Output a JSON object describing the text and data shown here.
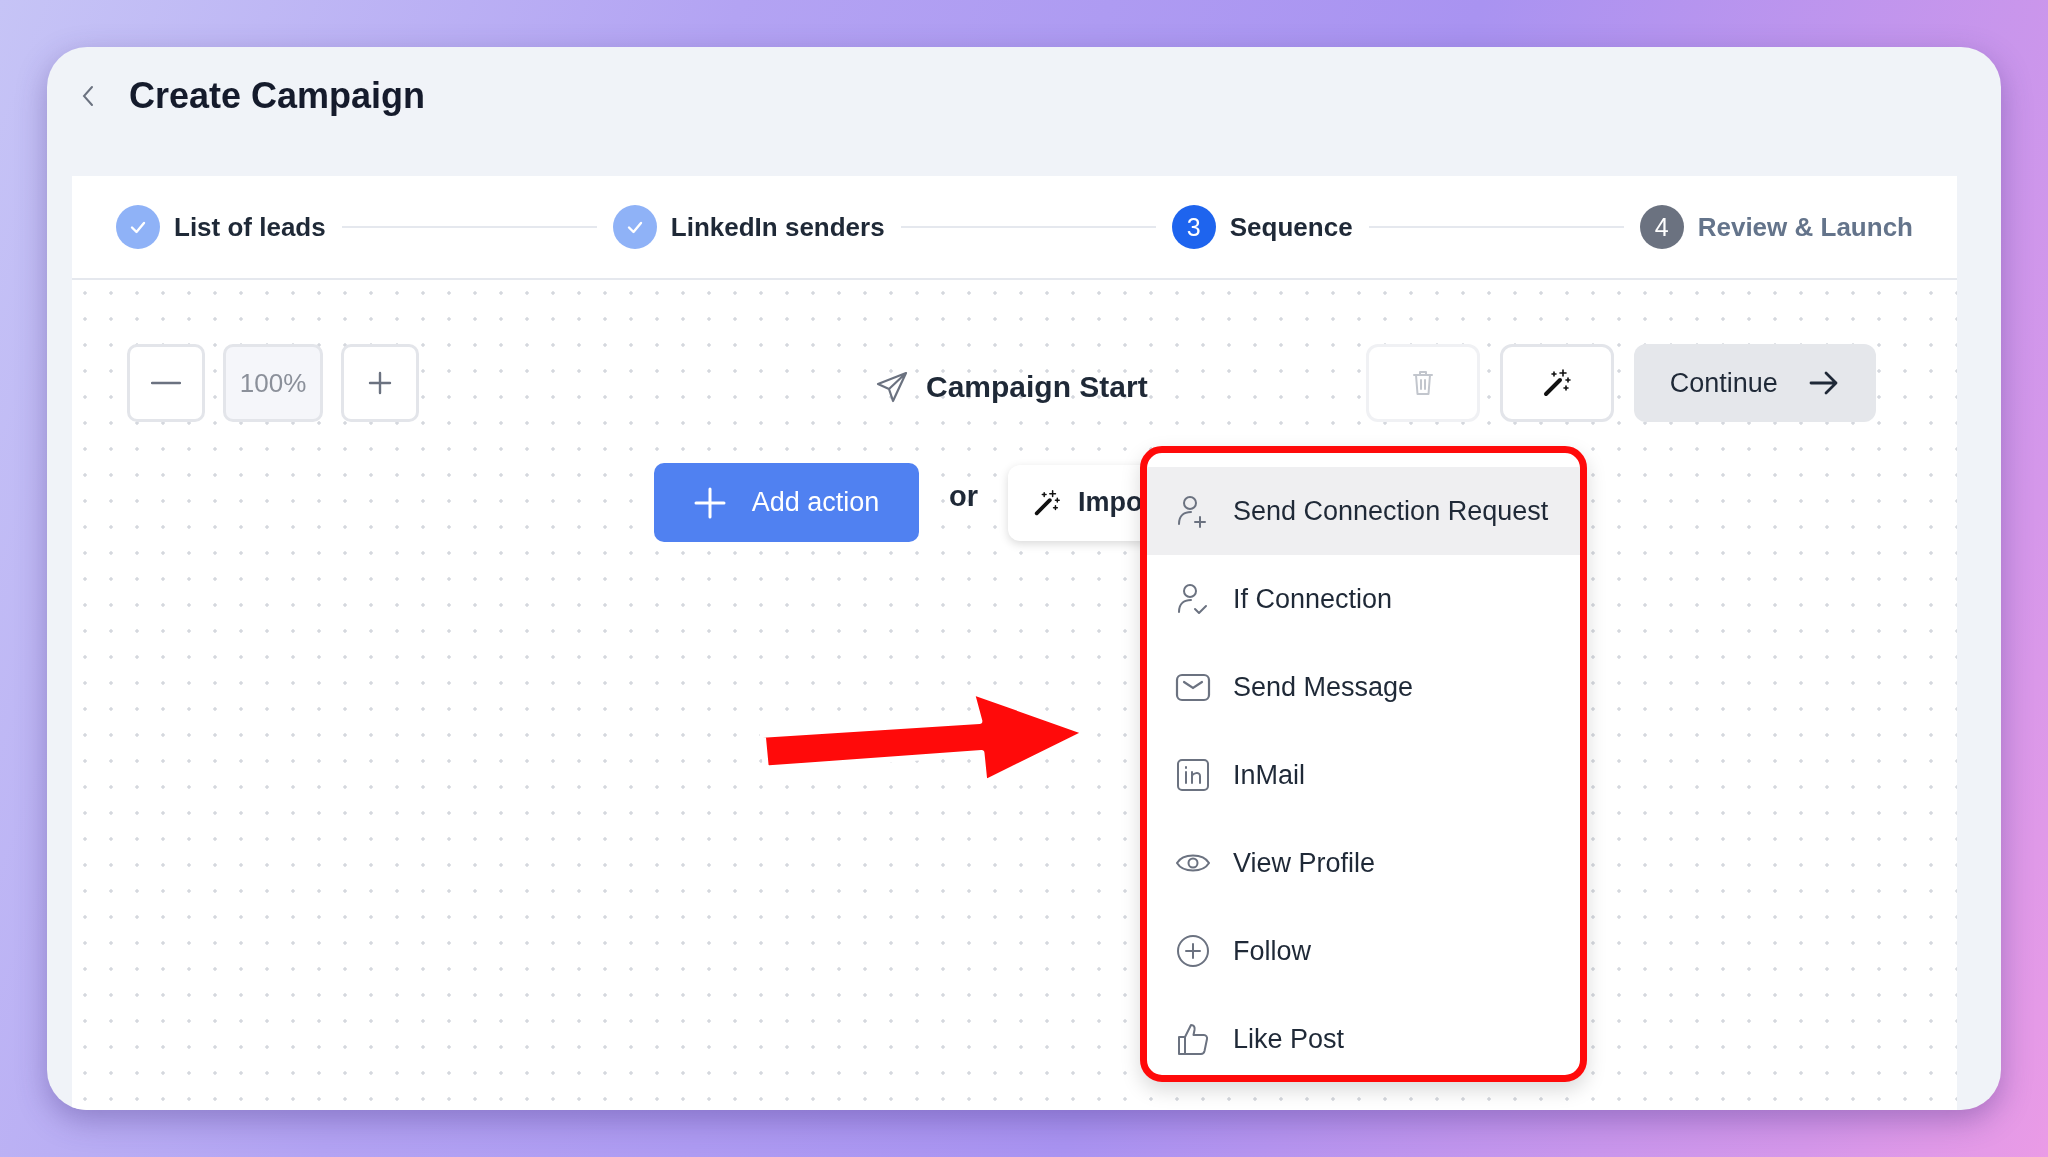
{
  "header": {
    "title": "Create Campaign"
  },
  "steps": [
    {
      "label": "List of leads",
      "completed": true,
      "selected": false
    },
    {
      "label": "LinkedIn senders",
      "completed": true,
      "selected": false
    },
    {
      "number": "3",
      "label": "Sequence",
      "completed": false,
      "selected": true
    },
    {
      "number": "4",
      "label": "Review & Launch",
      "completed": false,
      "selected": false
    }
  ],
  "toolbar": {
    "zoom_value": "100%",
    "delete_disabled": true,
    "continue_label": "Continue"
  },
  "canvas": {
    "start_label": "Campaign Start",
    "add_action_label": "Add action",
    "or_label": "or",
    "import_label": "Impo"
  },
  "action_menu": {
    "items": [
      {
        "kind": "connect",
        "label": "Send Connection Request",
        "selected": true
      },
      {
        "kind": "if-connection",
        "label": "If Connection",
        "selected": false
      },
      {
        "kind": "message",
        "label": "Send Message",
        "selected": false
      },
      {
        "kind": "inmail",
        "label": "InMail",
        "selected": false
      },
      {
        "kind": "view",
        "label": "View Profile",
        "selected": false
      },
      {
        "kind": "follow",
        "label": "Follow",
        "selected": false
      },
      {
        "kind": "like",
        "label": "Like Post",
        "selected": false
      }
    ]
  }
}
